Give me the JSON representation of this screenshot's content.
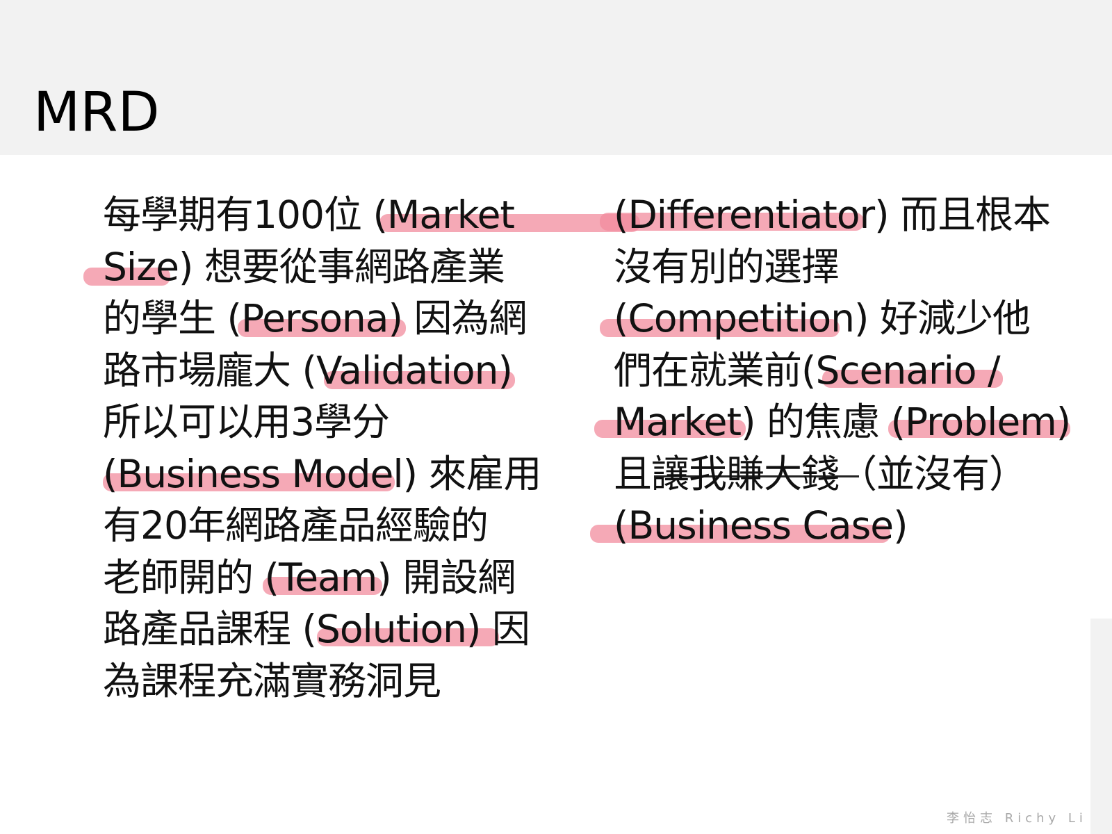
{
  "slide": {
    "title": "MRD",
    "footer": "李怡志 Richy Li",
    "highlight_color": "#f28c9d",
    "header_bg": "#f2f2f2",
    "left_lines": [
      "每學期有100位 (Market",
      "Size) 想要從事網路產業",
      "的學生 (Persona) 因為網",
      "路市場龐大 (Validation)",
      "所以可以用3學分",
      "(Business Model) 來雇用",
      "有20年網路產品經驗的",
      "老師開的 (Team) 開設網",
      "路產品課程 (Solution) 因",
      "為課程充滿實務洞見"
    ],
    "right_lines": [
      "(Differentiator) 而且根本",
      "沒有別的選擇",
      "(Competition) 好減少他",
      "們在就業前(Scenario /",
      "Market) 的焦慮 (Problem)",
      "且讓我賺大錢（並沒有）",
      "(Business Case)"
    ]
  }
}
